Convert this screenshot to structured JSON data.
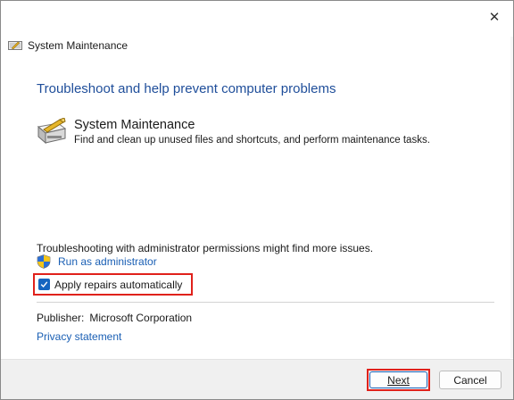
{
  "window": {
    "title": "System Maintenance",
    "close_glyph": "✕"
  },
  "main": {
    "heading": "Troubleshoot and help prevent computer problems",
    "task": {
      "title": "System Maintenance",
      "description": "Find and clean up unused files and shortcuts, and perform maintenance tasks."
    },
    "permission_note": "Troubleshooting with administrator permissions might find more issues.",
    "run_as_admin": "Run as administrator",
    "apply_repairs": {
      "label": "Apply repairs automatically",
      "checked": true
    },
    "publisher_label": "Publisher:",
    "publisher_value": "Microsoft Corporation",
    "privacy_link": "Privacy statement"
  },
  "footer": {
    "next_label": "Next",
    "cancel_label": "Cancel"
  },
  "colors": {
    "heading": "#1f4e9a",
    "link": "#1a5fb4",
    "checkbox": "#1565c0",
    "highlight_box": "#e0211b"
  },
  "icons": {
    "header": "maintenance-icon",
    "task": "maintenance-icon",
    "admin": "uac-shield-icon",
    "close": "close-icon"
  }
}
